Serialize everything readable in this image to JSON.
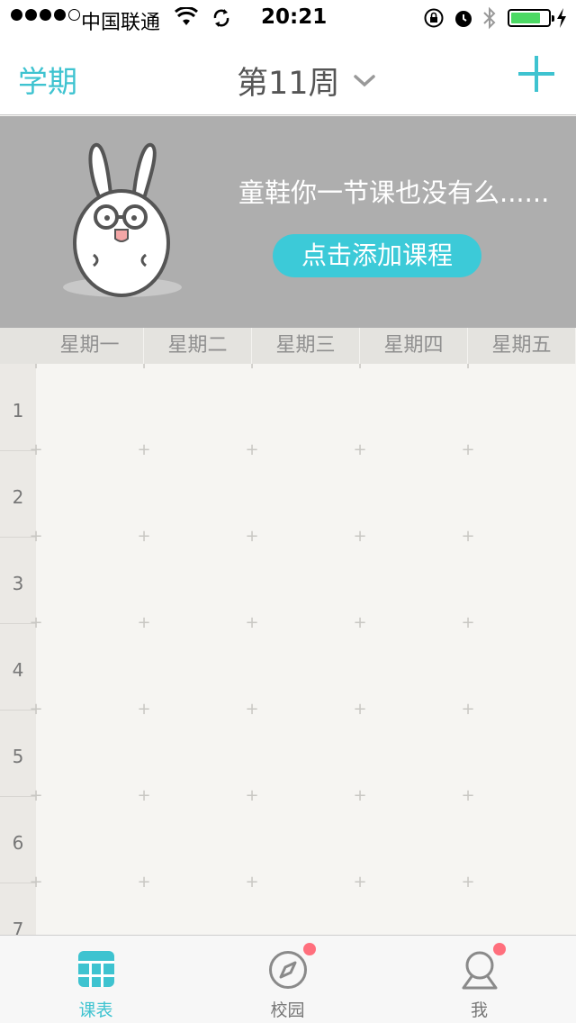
{
  "status_bar": {
    "carrier": "中国联通",
    "time": "20:21"
  },
  "nav": {
    "left_label": "学期",
    "title": "第11周"
  },
  "banner": {
    "message": "童鞋你一节课也没有么......",
    "button_label": "点击添加课程"
  },
  "days": [
    "星期一",
    "星期二",
    "星期三",
    "星期四",
    "星期五"
  ],
  "active_day": "星期一",
  "slots": [
    "1",
    "2",
    "3",
    "4",
    "5",
    "6",
    "7"
  ],
  "tabs": [
    {
      "label": "课表",
      "icon": "schedule-icon",
      "active": true,
      "badge": false
    },
    {
      "label": "校园",
      "icon": "compass-icon",
      "active": false,
      "badge": true
    },
    {
      "label": "我",
      "icon": "profile-icon",
      "active": false,
      "badge": true
    }
  ],
  "colors": {
    "accent": "#3ec3d0",
    "button": "#3ccad8",
    "banner_bg": "#aeaeae",
    "badge": "#ff6f7d"
  }
}
